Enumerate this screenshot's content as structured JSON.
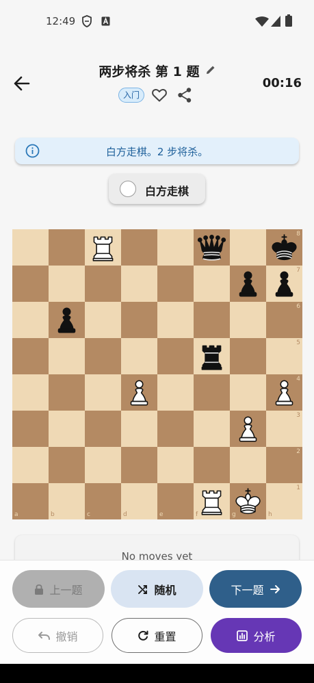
{
  "status_bar": {
    "time": "12:49",
    "left_icons": [
      "shield-icon",
      "a-letter-icon"
    ],
    "right_icons": [
      "wifi-icon",
      "signal-icon",
      "battery-icon"
    ]
  },
  "header": {
    "title": "两步将杀 第 1 题",
    "level": "入门",
    "timer": "00:16"
  },
  "banner": {
    "text": "白方走棋。2 步将杀。"
  },
  "side_to_move": {
    "label": "白方走棋"
  },
  "board": {
    "files": [
      "a",
      "b",
      "c",
      "d",
      "e",
      "f",
      "g",
      "h"
    ],
    "ranks": [
      "8",
      "7",
      "6",
      "5",
      "4",
      "3",
      "2",
      "1"
    ],
    "pieces": [
      {
        "square": "c8",
        "piece": "white-rook"
      },
      {
        "square": "f8",
        "piece": "black-queen"
      },
      {
        "square": "h8",
        "piece": "black-king"
      },
      {
        "square": "g7",
        "piece": "black-pawn"
      },
      {
        "square": "h7",
        "piece": "black-pawn"
      },
      {
        "square": "b6",
        "piece": "black-pawn"
      },
      {
        "square": "f5",
        "piece": "black-rook"
      },
      {
        "square": "d4",
        "piece": "white-pawn"
      },
      {
        "square": "h4",
        "piece": "white-pawn"
      },
      {
        "square": "g3",
        "piece": "white-pawn"
      },
      {
        "square": "f1",
        "piece": "white-rook"
      },
      {
        "square": "g1",
        "piece": "white-king"
      }
    ]
  },
  "moves": {
    "empty_text": "No moves yet"
  },
  "buttons": {
    "prev": "上一题",
    "random": "随机",
    "next": "下一题",
    "undo": "撤销",
    "reset": "重置",
    "analyze": "分析"
  },
  "colors": {
    "light_square": "#efd9b5",
    "dark_square": "#b48a63",
    "primary_blue": "#2f5f8a",
    "analyze_purple": "#6637b5"
  }
}
